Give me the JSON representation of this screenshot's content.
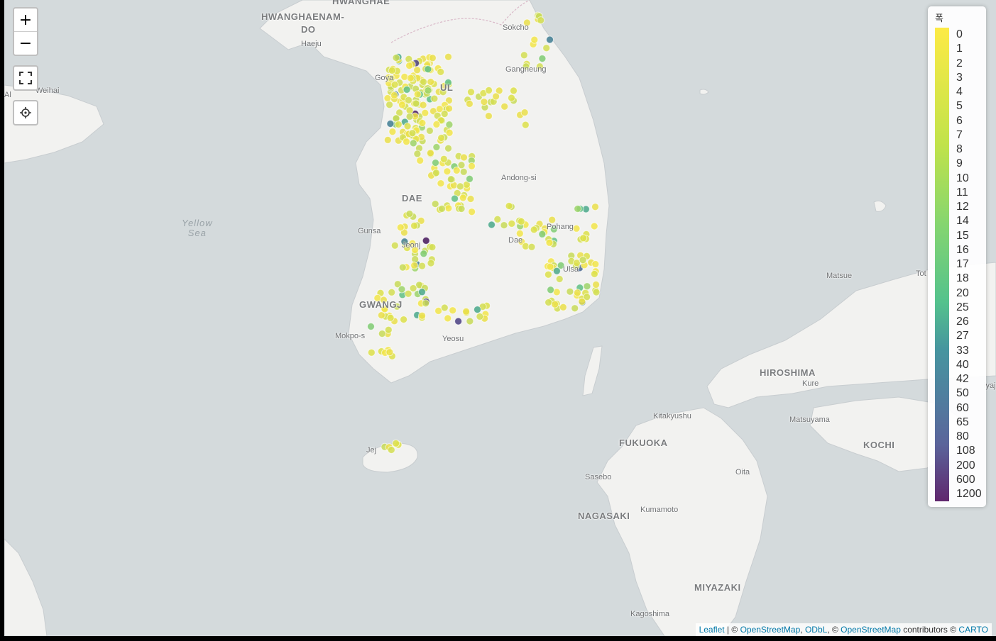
{
  "controls": {
    "zoom_in": "+",
    "zoom_out": "−",
    "fullscreen_icon": "fullscreen-icon",
    "locate_icon": "crosshair-icon"
  },
  "places": [
    {
      "name": "HWANGHAE",
      "cls": "big",
      "id": "hwanghae"
    },
    {
      "name": "HWANGHAENAM-",
      "cls": "big",
      "id": "hwanghaenam"
    },
    {
      "name": "DO",
      "cls": "big",
      "id": "do"
    },
    {
      "name": "Haeju",
      "cls": "",
      "id": "haeju"
    },
    {
      "name": "Weihai",
      "cls": "",
      "id": "weihai"
    },
    {
      "name": "Goya",
      "cls": "",
      "id": "goya"
    },
    {
      "name": "UL",
      "cls": "big",
      "id": "seoul"
    },
    {
      "name": "Sokcho",
      "cls": "",
      "id": "sokcho"
    },
    {
      "name": "Gangneung",
      "cls": "",
      "id": "gangneung"
    },
    {
      "name": "Andong-si",
      "cls": "",
      "id": "andong"
    },
    {
      "name": "DAE",
      "cls": "big",
      "id": "daejeon"
    },
    {
      "name": "Gunsa",
      "cls": "",
      "id": "gunsan"
    },
    {
      "name": "Jeonj",
      "cls": "",
      "id": "jeonju"
    },
    {
      "name": "Pohang",
      "cls": "",
      "id": "pohang"
    },
    {
      "name": "Dae",
      "cls": "",
      "id": "daegu"
    },
    {
      "name": "Ulsa",
      "cls": "",
      "id": "ulsan"
    },
    {
      "name": "GWANGJ",
      "cls": "big",
      "id": "gwangju"
    },
    {
      "name": "Mokpo-s",
      "cls": "",
      "id": "mokpo"
    },
    {
      "name": "Yeosu",
      "cls": "",
      "id": "yeosu"
    },
    {
      "name": "Jej",
      "cls": "",
      "id": "jeju"
    },
    {
      "name": "Matsue",
      "cls": "",
      "id": "matsue"
    },
    {
      "name": "Tot",
      "cls": "",
      "id": "tottori"
    },
    {
      "name": "HIROSHIMA",
      "cls": "big",
      "id": "hiroshima"
    },
    {
      "name": "Kure",
      "cls": "",
      "id": "kure"
    },
    {
      "name": "Kitakyushu",
      "cls": "",
      "id": "kitakyushu"
    },
    {
      "name": "FUKUOKA",
      "cls": "big",
      "id": "fukuoka"
    },
    {
      "name": "Matsuyama",
      "cls": "",
      "id": "matsuyama"
    },
    {
      "name": "KOCHI",
      "cls": "big",
      "id": "kochi"
    },
    {
      "name": "Oita",
      "cls": "",
      "id": "oita"
    },
    {
      "name": "Sasebo",
      "cls": "",
      "id": "sasebo"
    },
    {
      "name": "NAGASAKI",
      "cls": "big",
      "id": "nagasaki"
    },
    {
      "name": "Kumamoto",
      "cls": "",
      "id": "kumamoto"
    },
    {
      "name": "MIYAZAKI",
      "cls": "big",
      "id": "miyazaki"
    },
    {
      "name": "Kagoshima",
      "cls": "",
      "id": "kagoshima"
    },
    {
      "name": "Al",
      "cls": "",
      "id": "al"
    },
    {
      "name": "iyaj",
      "cls": "",
      "id": "iyaj"
    }
  ],
  "sea": {
    "line1": "Yellow",
    "line2": "Sea"
  },
  "legend": {
    "title": "폭",
    "labels": [
      "0",
      "1",
      "2",
      "3",
      "4",
      "5",
      "6",
      "7",
      "8",
      "9",
      "10",
      "11",
      "12",
      "14",
      "15",
      "16",
      "17",
      "18",
      "20",
      "25",
      "26",
      "27",
      "33",
      "40",
      "42",
      "50",
      "60",
      "65",
      "80",
      "108",
      "200",
      "600",
      "1200"
    ]
  },
  "attribution": {
    "leaflet": "Leaflet",
    "sep1": " | © ",
    "osm1": "OpenStreetMap",
    "comma": ", ",
    "odbl": "ODbL",
    "sep2": ", © ",
    "osm2": "OpenStreetMap",
    "contributors": " contributors © ",
    "carto": "CARTO"
  },
  "colors": {
    "water": "#d4dadc",
    "land": "#f2f2f0",
    "marker_low": "#fde725",
    "marker_high": "#440154"
  }
}
